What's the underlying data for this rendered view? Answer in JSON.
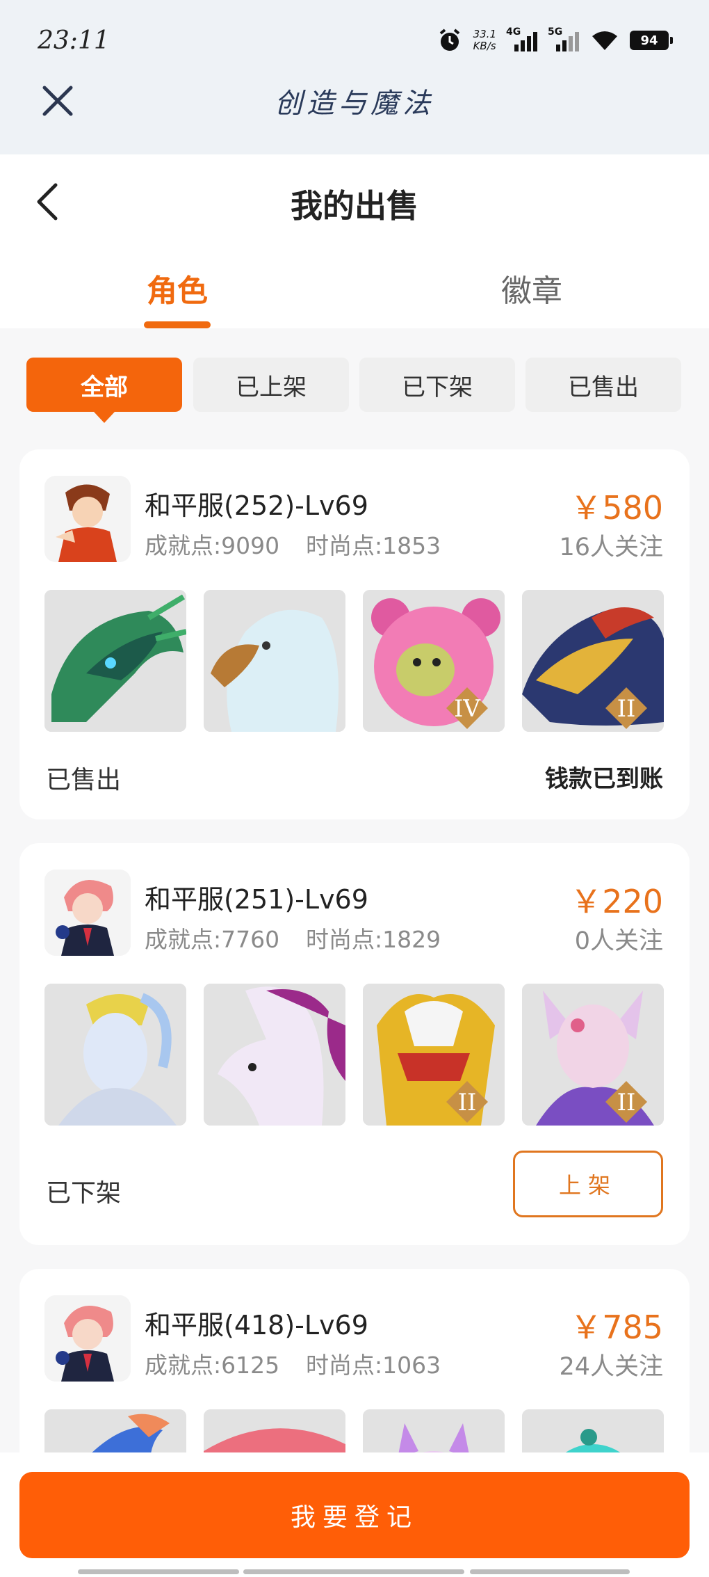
{
  "status_bar": {
    "time": "23:11",
    "net_speed_value": "33.1",
    "net_speed_unit": "KB/s",
    "signal1_label": "4G",
    "signal2_label": "5G",
    "battery": "94"
  },
  "app": {
    "title": "创造与魔法"
  },
  "page": {
    "title": "我的出售"
  },
  "tabs": [
    {
      "label": "角色",
      "active": true
    },
    {
      "label": "徽章",
      "active": false
    }
  ],
  "filters": [
    {
      "label": "全部",
      "active": true
    },
    {
      "label": "已上架",
      "active": false
    },
    {
      "label": "已下架",
      "active": false
    },
    {
      "label": "已售出",
      "active": false
    }
  ],
  "listings": [
    {
      "server": "和平服(252)-Lv69",
      "achievement": "成就点:9090",
      "fashion": "时尚点:1853",
      "price": "￥580",
      "followers": "16人关注",
      "status": "已售出",
      "note": "钱款已到账",
      "thumbs": [
        {
          "icon": "green-dragon-mount",
          "rank": ""
        },
        {
          "icon": "white-eagle-mount",
          "rank": ""
        },
        {
          "icon": "pink-bear-mount",
          "rank": "IV"
        },
        {
          "icon": "fire-dragon-mount",
          "rank": "II"
        }
      ]
    },
    {
      "server": "和平服(251)-Lv69",
      "achievement": "成就点:7760",
      "fashion": "时尚点:1829",
      "price": "￥220",
      "followers": "0人关注",
      "status": "已下架",
      "action": "上架",
      "thumbs": [
        {
          "icon": "moon-fairy-outfit",
          "rank": ""
        },
        {
          "icon": "white-deer-mount",
          "rank": ""
        },
        {
          "icon": "golden-armor-outfit",
          "rank": "II"
        },
        {
          "icon": "fox-spirit-outfit",
          "rank": "II"
        }
      ]
    },
    {
      "server": "和平服(418)-Lv69",
      "achievement": "成就点:6125",
      "fashion": "时尚点:1063",
      "price": "￥785",
      "followers": "24人关注",
      "thumbs": [
        {
          "icon": "blue-bird-mount",
          "rank": ""
        },
        {
          "icon": "pink-fish-mount",
          "rank": ""
        },
        {
          "icon": "purple-horn-outfit",
          "rank": ""
        },
        {
          "icon": "teal-blob-pet",
          "rank": ""
        }
      ]
    }
  ],
  "footer": {
    "register": "我要登记"
  },
  "colors": {
    "accent": "#f4650c",
    "price": "#e8721c",
    "button": "#ff5e07"
  }
}
